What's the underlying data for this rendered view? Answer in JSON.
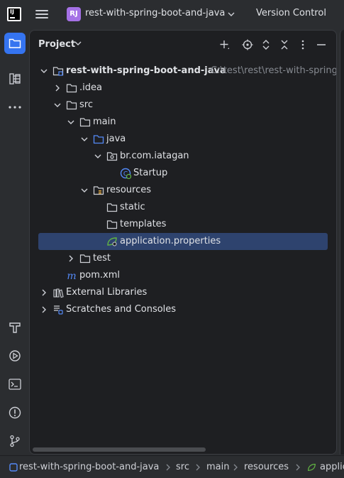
{
  "titlebar": {
    "project_badge": "RJ",
    "project_name": "rest-with-spring-boot-and-java",
    "vcs_label": "Version Control"
  },
  "left_strip": {
    "top": [
      "project-icon",
      "structure-icon",
      "more-icon"
    ],
    "bottom": [
      "build-icon",
      "run-icon",
      "terminal-icon",
      "problems-icon",
      "git-icon"
    ]
  },
  "panel": {
    "title": "Project",
    "header_icons": [
      "add-icon",
      "locate-icon",
      "expand-all-icon",
      "collapse-all-icon",
      "options-icon",
      "minimize-icon"
    ]
  },
  "tree": [
    {
      "label": "rest-with-spring-boot-and-java",
      "path": "C:\\test\\rest\\rest-with-spring-boot-and-java",
      "icon": "module-folder",
      "expanded": true,
      "bold": true
    },
    {
      "label": ".idea",
      "icon": "folder",
      "expanded": false
    },
    {
      "label": "src",
      "icon": "folder",
      "expanded": true
    },
    {
      "label": "main",
      "icon": "folder",
      "expanded": true
    },
    {
      "label": "java",
      "icon": "source-folder",
      "expanded": true
    },
    {
      "label": "br.com.iatagan",
      "icon": "package",
      "expanded": true
    },
    {
      "label": "Startup",
      "icon": "spring-class"
    },
    {
      "label": "resources",
      "icon": "resources-folder",
      "expanded": true
    },
    {
      "label": "static",
      "icon": "folder"
    },
    {
      "label": "templates",
      "icon": "folder"
    },
    {
      "label": "application.properties",
      "icon": "spring-properties",
      "selected": true
    },
    {
      "label": "test",
      "icon": "folder",
      "expanded": false
    },
    {
      "label": "pom.xml",
      "icon": "maven"
    },
    {
      "label": "External Libraries",
      "icon": "libraries",
      "expanded": false
    },
    {
      "label": "Scratches and Consoles",
      "icon": "scratches",
      "expanded": false
    }
  ],
  "breadcrumbs": [
    "rest-with-spring-boot-and-java",
    "src",
    "main",
    "resources",
    "applic"
  ],
  "colors": {
    "accent": "#3574f0",
    "selection": "#2e436e",
    "panel_bg": "#1e1f22",
    "chrome_bg": "#2b2d30",
    "badge": "#a571e6"
  }
}
